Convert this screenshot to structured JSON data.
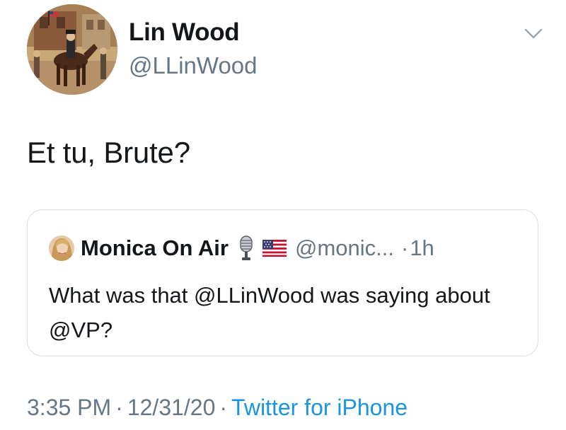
{
  "author": {
    "display_name": "Lin Wood",
    "handle": "@LLinWood",
    "avatar_icon": "painting-avatar",
    "menu_icon": "chevron-down-icon"
  },
  "tweet": {
    "text": "Et tu, Brute?"
  },
  "quoted_tweet": {
    "avatar_icon": "profile-photo-avatar",
    "display_name": "Monica On Air",
    "name_emojis": [
      "microphone-icon",
      "us-flag-icon"
    ],
    "handle": "@monic...",
    "dot": "·",
    "time": "1h",
    "text": "What was that @LLinWood was saying about @VP?"
  },
  "meta": {
    "time": "3:35 PM",
    "separator": "·",
    "date": "12/31/20",
    "source": "Twitter for iPhone"
  },
  "colors": {
    "text_primary": "#14171a",
    "text_secondary": "#657786",
    "link": "#1b95e0",
    "card_border": "#d8dee3"
  }
}
